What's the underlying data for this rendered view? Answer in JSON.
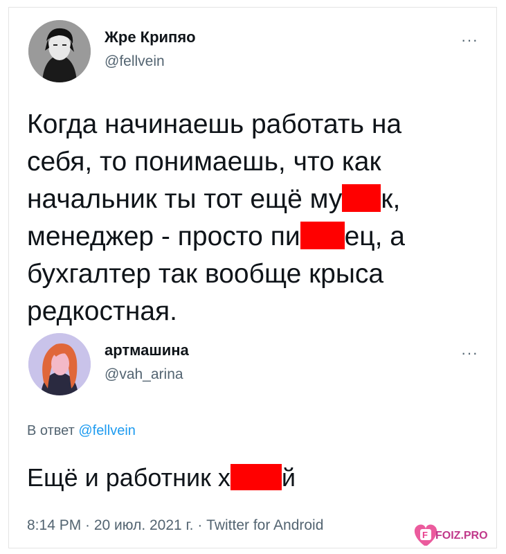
{
  "tweet1": {
    "display_name": "Жре Крипяо",
    "handle": "@fellvein",
    "more_icon": "···",
    "text_lines": [
      "Когда начинаешь работать на",
      "себя, то понимаешь, что как"
    ],
    "line3_prefix": "начальник ты тот ещё му",
    "line3_suffix": "к,",
    "line4_prefix": "менеджер - просто пи",
    "line4_suffix": "ец, а",
    "line5": "бухгалтер так вообще крыса",
    "line6": "редкостная."
  },
  "tweet2": {
    "display_name": "артмашина",
    "handle": "@vah_arina",
    "more_icon": "···",
    "reply_prefix": "В ответ",
    "reply_handle": "@fellvein",
    "text_prefix": "Ещё и работник х",
    "text_suffix": "й",
    "meta": "8:14 PM · 20 июл. 2021 г. · Twitter for Android"
  },
  "watermark": {
    "text": "FOIZ.PRO",
    "colors": {
      "heart": "#e83e8c",
      "redaction": "#ff0000",
      "link": "#1d9bf0"
    }
  }
}
